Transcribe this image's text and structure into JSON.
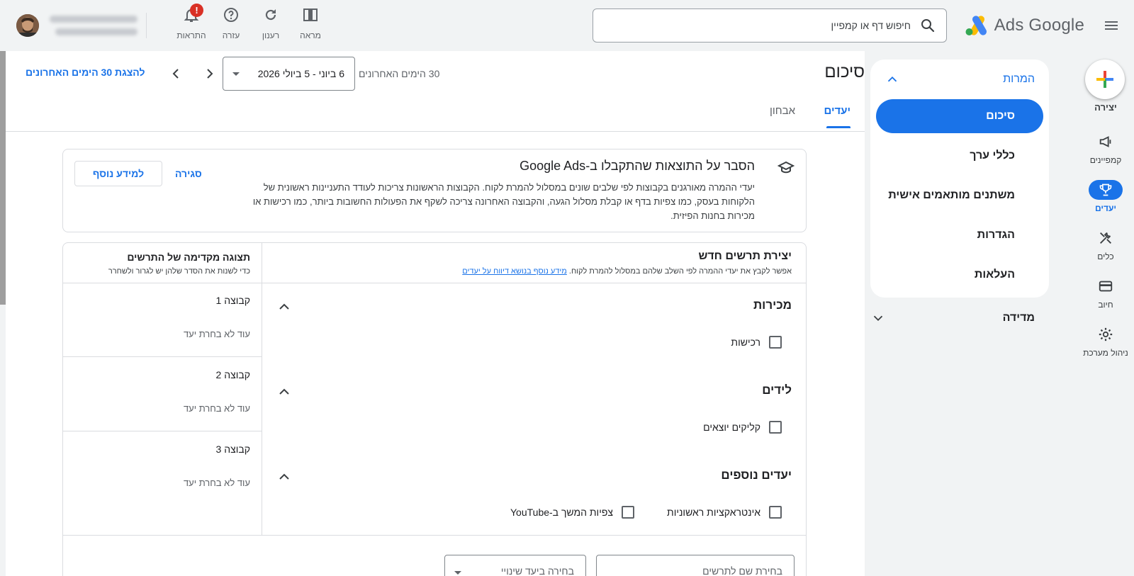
{
  "topbar": {
    "search_placeholder": "חיפוש דף או קמפיין",
    "logo_text": "Ads Google",
    "tools": [
      {
        "label": "מראה",
        "icon": "appearance-icon"
      },
      {
        "label": "רענון",
        "icon": "refresh-icon"
      },
      {
        "label": "עזרה",
        "icon": "help-icon"
      },
      {
        "label": "התראות",
        "icon": "bell-icon",
        "badge": "!"
      }
    ]
  },
  "rail": {
    "create_label": "יצירה",
    "items": [
      {
        "label": "קמפיינים",
        "icon": "campaigns-icon"
      },
      {
        "label": "יעדים",
        "icon": "trophy-icon",
        "active": true
      },
      {
        "label": "כלים",
        "icon": "tools-icon"
      },
      {
        "label": "חיוב",
        "icon": "billing-icon"
      },
      {
        "label": "ניהול מערכת",
        "icon": "gear-icon"
      }
    ]
  },
  "section_nav": {
    "title": "המרות",
    "items": [
      "סיכום",
      "כללי ערך",
      "משתנים מותאמים אישית",
      "הגדרות",
      "העלאות"
    ],
    "active_index": 0,
    "collapsed_section": "מדידה"
  },
  "header": {
    "page_title": "סיכום",
    "range_label": "30 הימים האחרונים",
    "date_range": "6 ביוני - 5 ביולי 2026",
    "show_last_30": "להצגת 30 הימים האחרונים",
    "tabs": [
      "יעדים",
      "אבחון"
    ],
    "active_tab": 0
  },
  "explain": {
    "title": "הסבר על התוצאות שהתקבלו ב-Google Ads",
    "body": "יעדי ההמרה מאורגנים בקבוצות לפי שלבים שונים במסלול להמרת לקוח. הקבוצות הראשונות צריכות לעודד התעניינות ראשונית של הלקוחות בעסק, כמו צפיות בדף או קבלת מסלול הגעה, והקבוצה האחרונה צריכה לשקף את הפעולות החשובות ביותר, כמו רכישות או מכירות בחנות הפיזית.",
    "close": "סגירה",
    "learn_more": "למידע נוסף"
  },
  "builder": {
    "title": "יצירת תרשים חדש",
    "subtitle": "אפשר לקבץ את יעדי ההמרה לפי השלב שלהם במסלול להמרת לקוח.",
    "subtitle_link": "מידע נוסף בנושא דיווח על יעדים",
    "categories": [
      {
        "title": "מכירות",
        "options": [
          "רכישות"
        ]
      },
      {
        "title": "לידים",
        "options": [
          "קליקים יוצאים"
        ]
      },
      {
        "title": "יעדים נוספים",
        "options": [
          "אינטראקציות ראשוניות",
          "צפיות המשך ב-YouTube"
        ]
      }
    ],
    "name_placeholder": "בחירת שם לתרשים",
    "goal_placeholder": "בחירה ביעד שינויי"
  },
  "preview": {
    "title": "תצוגה מקדימה של התרשים",
    "subtitle": "כדי לשנות את הסדר שלהן יש לגרור ולשחרר",
    "groups": [
      {
        "name": "קבוצה 1",
        "status": "עוד לא בחרת יעד"
      },
      {
        "name": "קבוצה 2",
        "status": "עוד לא בחרת יעד"
      },
      {
        "name": "קבוצה 3",
        "status": "עוד לא בחרת יעד"
      }
    ]
  },
  "colors": {
    "accent": "#1a73e8",
    "badge": "#d93025",
    "bg": "#f1f3f4"
  }
}
